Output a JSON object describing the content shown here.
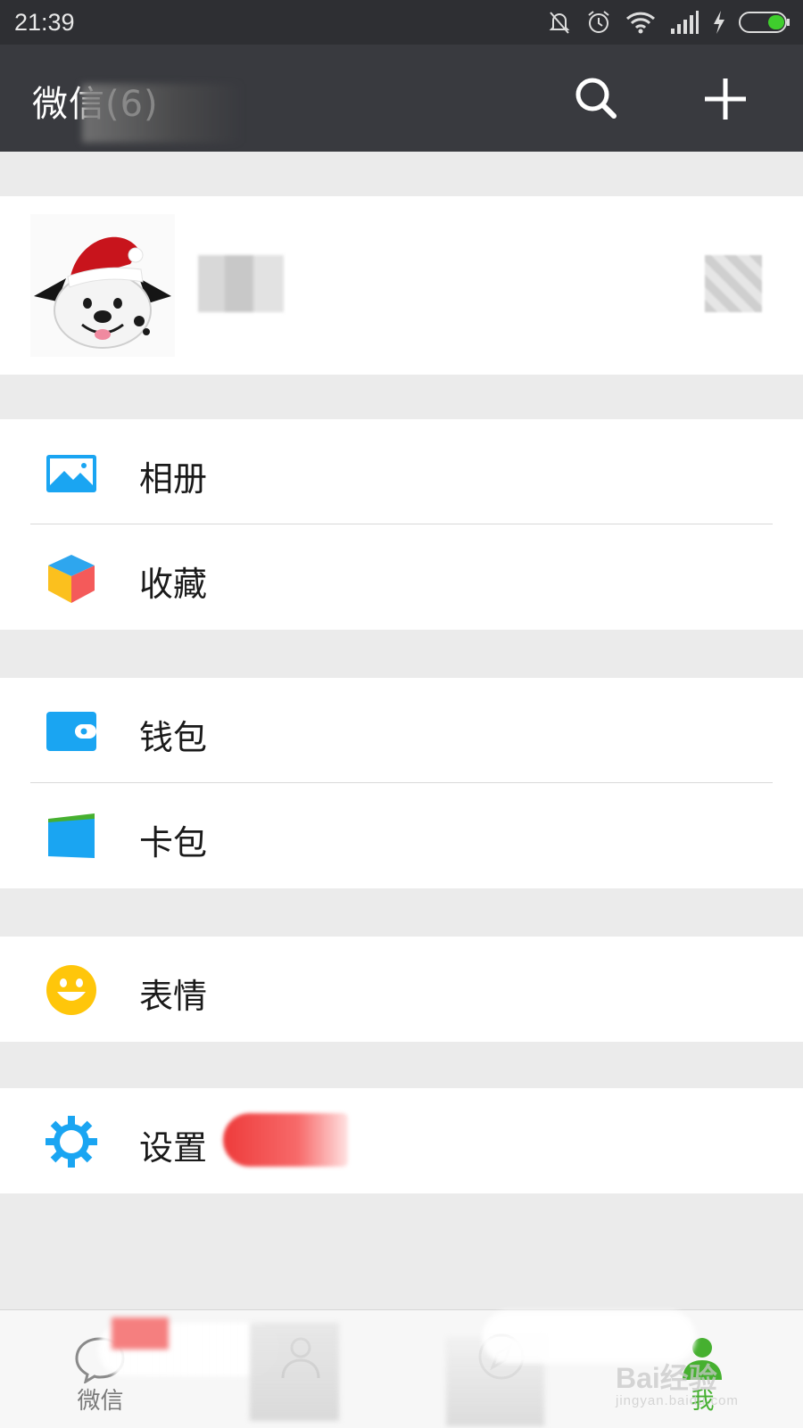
{
  "status_bar": {
    "time": "21:39",
    "icons": [
      "bell-muted-icon",
      "alarm-icon",
      "wifi-icon",
      "signal-icon",
      "charging-icon",
      "battery-icon"
    ]
  },
  "header": {
    "title": "微信(6)",
    "actions": [
      "search-icon",
      "plus-icon"
    ]
  },
  "menu": {
    "album": "相册",
    "favorites": "收藏",
    "wallet": "钱包",
    "card_package": "卡包",
    "stickers": "表情",
    "settings": "设置"
  },
  "tabbar": {
    "tabs": [
      {
        "label": "微信",
        "icon": "chat-bubble-icon",
        "active": false
      },
      {
        "label": "",
        "icon": "contacts-icon",
        "active": false
      },
      {
        "label": "",
        "icon": "discover-icon",
        "active": false
      },
      {
        "label": "我",
        "icon": "me-icon",
        "active": true
      }
    ],
    "active_color": "#46b030"
  },
  "watermark": {
    "text": "Bai经验",
    "sub": "jingyan.baidu.com"
  },
  "colors": {
    "header_bg": "#393a3f",
    "accent_blue": "#1aa5f2",
    "accent_green": "#46b030",
    "background": "#ebebeb"
  }
}
